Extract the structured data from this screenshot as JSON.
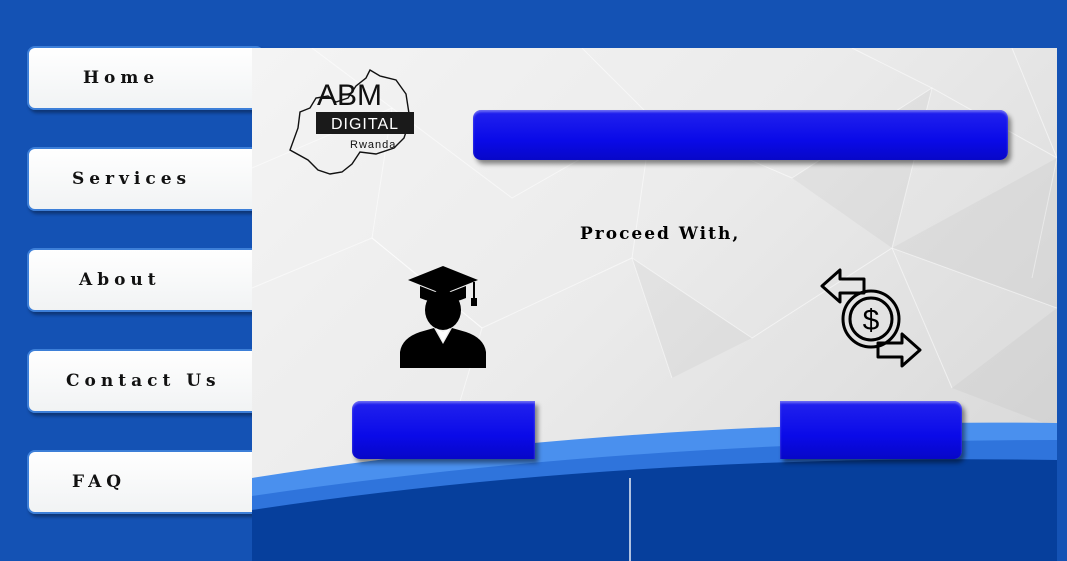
{
  "nav": {
    "home": "Home",
    "services": "Services",
    "about": "About",
    "contact": "Contact Us",
    "faq": "FAQ"
  },
  "logo": {
    "line1": "ABM",
    "line2": "DIGITAL",
    "line3": "Rwanda"
  },
  "main": {
    "heading": "Proceed With,",
    "icon_left": "graduate-icon",
    "icon_right": "money-exchange-icon"
  },
  "colors": {
    "page_bg": "#1452b4",
    "button_blue": "#0a0ae8",
    "wave_light": "#3b82e8"
  }
}
